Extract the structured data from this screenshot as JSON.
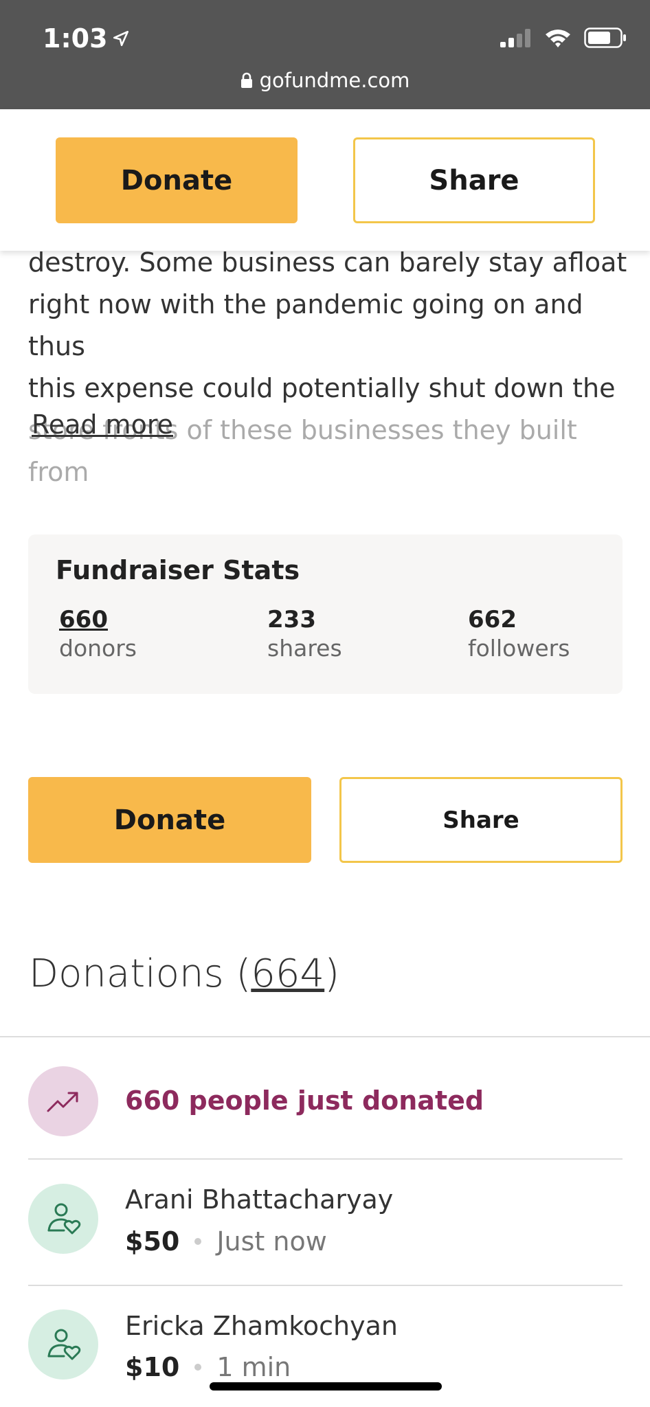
{
  "status_bar": {
    "time": "1:03",
    "url": "gofundme.com"
  },
  "sticky_bar": {
    "donate_label": "Donate",
    "share_label": "Share"
  },
  "story": {
    "lines": [
      "destroy. Some business can barely stay afloat",
      "right now with the pandemic going on and thus",
      "this expense could potentially shut down the",
      "store fronts of these businesses they built from"
    ],
    "read_more": "Read more"
  },
  "stats": {
    "title": "Fundraiser Stats",
    "donors": {
      "value": "660",
      "label": "donors"
    },
    "shares": {
      "value": "233",
      "label": "shares"
    },
    "followers": {
      "value": "662",
      "label": "followers"
    }
  },
  "actions": {
    "donate_label": "Donate",
    "share_label": "Share"
  },
  "donations": {
    "title_prefix": "Donations (",
    "count": "664",
    "title_suffix": ")",
    "trending_text": "660 people just donated",
    "items": [
      {
        "name": "Arani Bhattacharyay",
        "amount": "$50",
        "time": "Just now"
      },
      {
        "name": "Ericka Zhamkochyan",
        "amount": "$10",
        "time": "1 min"
      }
    ]
  },
  "colors": {
    "donate": "#f8b94b",
    "share_border": "#f3c64a",
    "trend": "#8d2a5d",
    "status_bg": "#555555"
  }
}
